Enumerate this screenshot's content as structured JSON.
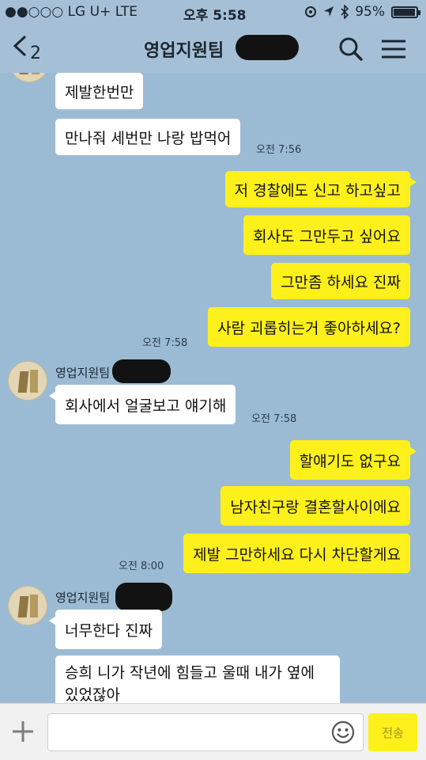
{
  "status_bar": {
    "carrier": "●●○○○ LG U+  LTE",
    "time": "오후 5:58",
    "battery": "95%",
    "battery_level": 0.95
  },
  "header": {
    "back_count": "2",
    "title": "영업지원팀",
    "icons": [
      "chevron-left-icon",
      "search-icon",
      "menu-icon"
    ]
  },
  "messages": {
    "m1": {
      "text": "제발한번만"
    },
    "m2": {
      "text": "만나줘 세번만 나랑 밥먹어",
      "time": "오전 7:56"
    },
    "m3": {
      "text": "저 경찰에도 신고 하고싶고"
    },
    "m4": {
      "text": "회사도 그만두고 싶어요"
    },
    "m5": {
      "text": "그만좀 하세요 진짜"
    },
    "m6": {
      "text": "사람 괴롭히는거 좋아하세요?",
      "time": "오전 7:58"
    },
    "sender1": "영업지원팀",
    "m7": {
      "text": "회사에서 얼굴보고 얘기해",
      "time": "오전 7:58"
    },
    "m8": {
      "text": "할얘기도 없구요"
    },
    "m9": {
      "text": "남자친구랑 결혼할사이에요"
    },
    "m10": {
      "text": "제발 그만하세요 다시 차단할게요",
      "time": "오전 8:00"
    },
    "sender2": "영업지원팀",
    "m11": {
      "text": "너무한다 진짜"
    },
    "m12": {
      "text": "승희 니가 작년에 힘들고 울때 내가 옆에 있었잖아"
    }
  },
  "input_bar": {
    "placeholder": "",
    "send_label": "전송"
  },
  "colors": {
    "chat_background": "#9bbbd4",
    "outgoing_bubble": "#fef01b",
    "incoming_bubble": "#ffffff"
  }
}
